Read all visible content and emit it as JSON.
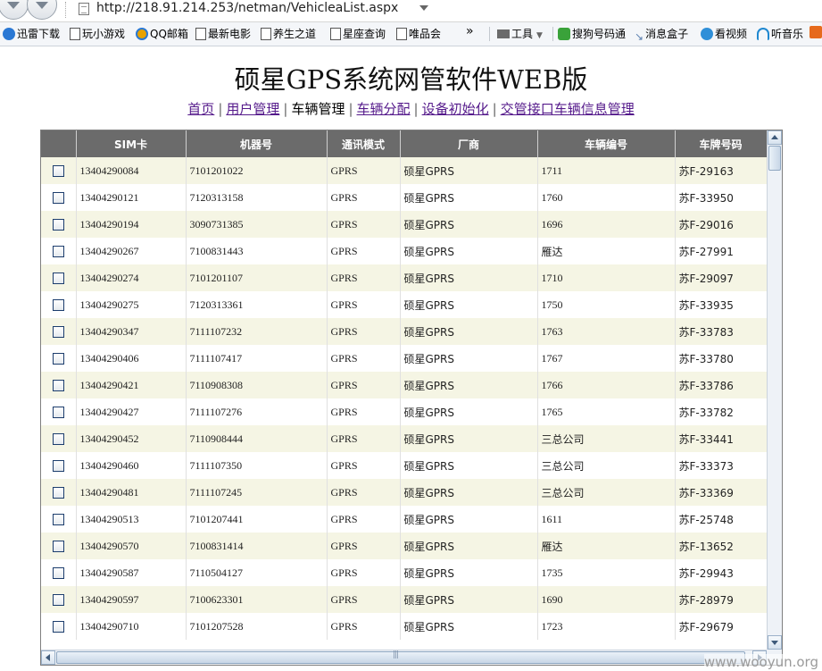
{
  "browser": {
    "url": "http://218.91.214.253/netman/VehicleaList.aspx",
    "favorites": [
      {
        "label": "迅雷下载",
        "icon": "thunder-icon",
        "color": "#2a78d4"
      },
      {
        "label": "玩小游戏",
        "icon": "page-icon",
        "color": "#555555"
      },
      {
        "label": "QQ邮箱",
        "icon": "qq-mail-icon",
        "color": "#e8a200"
      },
      {
        "label": "最新电影",
        "icon": "page-icon",
        "color": "#555555"
      },
      {
        "label": "养生之道",
        "icon": "page-icon",
        "color": "#555555"
      },
      {
        "label": "星座查询",
        "icon": "page-icon",
        "color": "#555555"
      },
      {
        "label": "唯品会",
        "icon": "page-icon",
        "color": "#555555"
      }
    ],
    "chevron": "»",
    "tools_label": "工具",
    "extras": [
      {
        "label": "搜狗号码通",
        "icon": "sogou-icon",
        "color": "#3aa23a"
      },
      {
        "label": "消息盒子",
        "icon": "message-box-icon",
        "color": "#5a7fb0"
      },
      {
        "label": "看视频",
        "icon": "video-icon",
        "color": "#2f8fd8"
      },
      {
        "label": "听音乐",
        "icon": "headphones-icon",
        "color": "#1f88d0"
      }
    ]
  },
  "page": {
    "title": "硕星GPS系统网管软件WEB版",
    "nav": [
      {
        "label": "首页",
        "current": false
      },
      {
        "label": "用户管理",
        "current": false
      },
      {
        "label": "车辆管理",
        "current": true
      },
      {
        "label": "车辆分配",
        "current": false
      },
      {
        "label": "设备初始化",
        "current": false
      },
      {
        "label": "交管接口车辆信息管理",
        "current": false
      }
    ]
  },
  "grid": {
    "columns": [
      "",
      "SIM卡",
      "机器号",
      "通讯模式",
      "厂商",
      "车辆编号",
      "车牌号码"
    ],
    "rows": [
      [
        "13404290084",
        "7101201022",
        "GPRS",
        "硕星GPRS",
        "1711",
        "苏F-29163"
      ],
      [
        "13404290121",
        "7120313158",
        "GPRS",
        "硕星GPRS",
        "1760",
        "苏F-33950"
      ],
      [
        "13404290194",
        "3090731385",
        "GPRS",
        "硕星GPRS",
        "1696",
        "苏F-29016"
      ],
      [
        "13404290267",
        "7100831443",
        "GPRS",
        "硕星GPRS",
        "雁达",
        "苏F-27991"
      ],
      [
        "13404290274",
        "7101201107",
        "GPRS",
        "硕星GPRS",
        "1710",
        "苏F-29097"
      ],
      [
        "13404290275",
        "7120313361",
        "GPRS",
        "硕星GPRS",
        "1750",
        "苏F-33935"
      ],
      [
        "13404290347",
        "7111107232",
        "GPRS",
        "硕星GPRS",
        "1763",
        "苏F-33783"
      ],
      [
        "13404290406",
        "7111107417",
        "GPRS",
        "硕星GPRS",
        "1767",
        "苏F-33780"
      ],
      [
        "13404290421",
        "7110908308",
        "GPRS",
        "硕星GPRS",
        "1766",
        "苏F-33786"
      ],
      [
        "13404290427",
        "7111107276",
        "GPRS",
        "硕星GPRS",
        "1765",
        "苏F-33782"
      ],
      [
        "13404290452",
        "7110908444",
        "GPRS",
        "硕星GPRS",
        "三总公司",
        "苏F-33441"
      ],
      [
        "13404290460",
        "7111107350",
        "GPRS",
        "硕星GPRS",
        "三总公司",
        "苏F-33373"
      ],
      [
        "13404290481",
        "7111107245",
        "GPRS",
        "硕星GPRS",
        "三总公司",
        "苏F-33369"
      ],
      [
        "13404290513",
        "7101207441",
        "GPRS",
        "硕星GPRS",
        "1611",
        "苏F-25748"
      ],
      [
        "13404290570",
        "7100831414",
        "GPRS",
        "硕星GPRS",
        "雁达",
        "苏F-13652"
      ],
      [
        "13404290587",
        "7110504127",
        "GPRS",
        "硕星GPRS",
        "1735",
        "苏F-29943"
      ],
      [
        "13404290597",
        "7100623301",
        "GPRS",
        "硕星GPRS",
        "1690",
        "苏F-28979"
      ],
      [
        "13404290710",
        "7101207528",
        "GPRS",
        "硕星GPRS",
        "1723",
        "苏F-29679"
      ]
    ]
  },
  "watermark": "www.wooyun.org"
}
